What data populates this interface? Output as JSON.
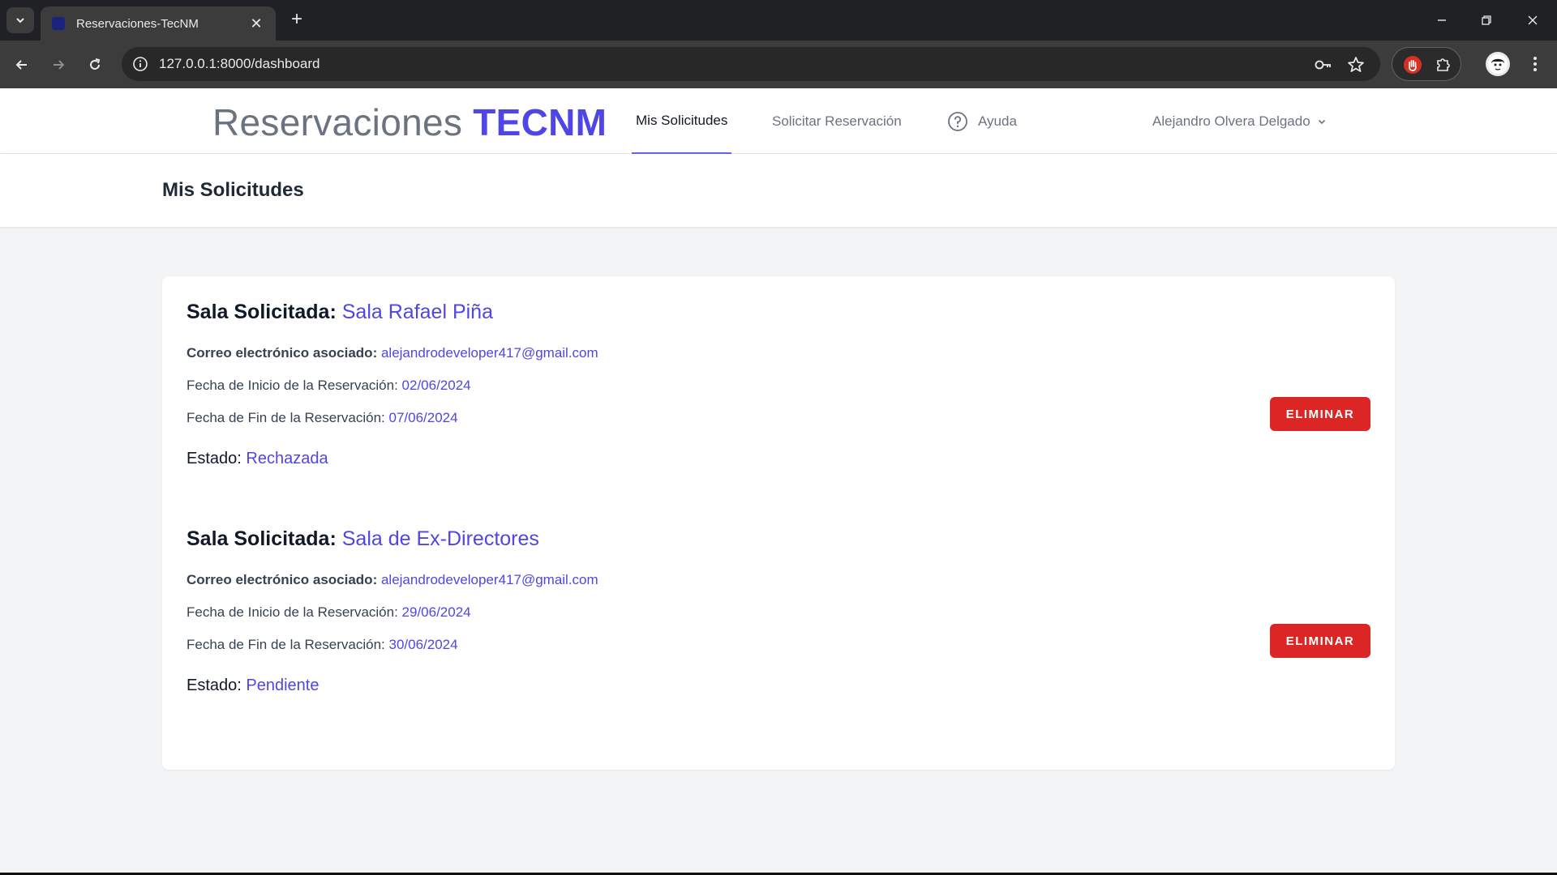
{
  "browser": {
    "tab_title": "Reservaciones-TecNM",
    "tab_close": "✕",
    "new_tab": "+",
    "url": "127.0.0.1:8000/dashboard"
  },
  "nav": {
    "brand_prefix": "Reservaciones ",
    "brand_accent": "TECNM",
    "links": [
      "Mis Solicitudes",
      "Solicitar Reservación",
      "Ayuda"
    ],
    "user_name": "Alejandro Olvera Delgado"
  },
  "header": {
    "title": "Mis Solicitudes"
  },
  "requests": [
    {
      "room_label": "Sala Solicitada:",
      "room": "Sala Rafael Piña",
      "email_label": "Correo electrónico asociado:",
      "email": "alejandrodeveloper417@gmail.com",
      "start_label": "Fecha de Inicio de la Reservación:",
      "start": "02/06/2024",
      "end_label": "Fecha de Fin de la Reservación:",
      "end": "07/06/2024",
      "status_label": "Estado:",
      "status": "Rechazada",
      "delete_label": "ELIMINAR"
    },
    {
      "room_label": "Sala Solicitada:",
      "room": "Sala de Ex-Directores",
      "email_label": "Correo electrónico asociado:",
      "email": "alejandrodeveloper417@gmail.com",
      "start_label": "Fecha de Inicio de la Reservación:",
      "start": "29/06/2024",
      "end_label": "Fecha de Fin de la Reservación:",
      "end": "30/06/2024",
      "status_label": "Estado:",
      "status": "Pendiente",
      "delete_label": "ELIMINAR"
    }
  ],
  "colors": {
    "accent": "#4f46e5",
    "danger": "#dc2626",
    "chrome_dark": "#202124"
  }
}
